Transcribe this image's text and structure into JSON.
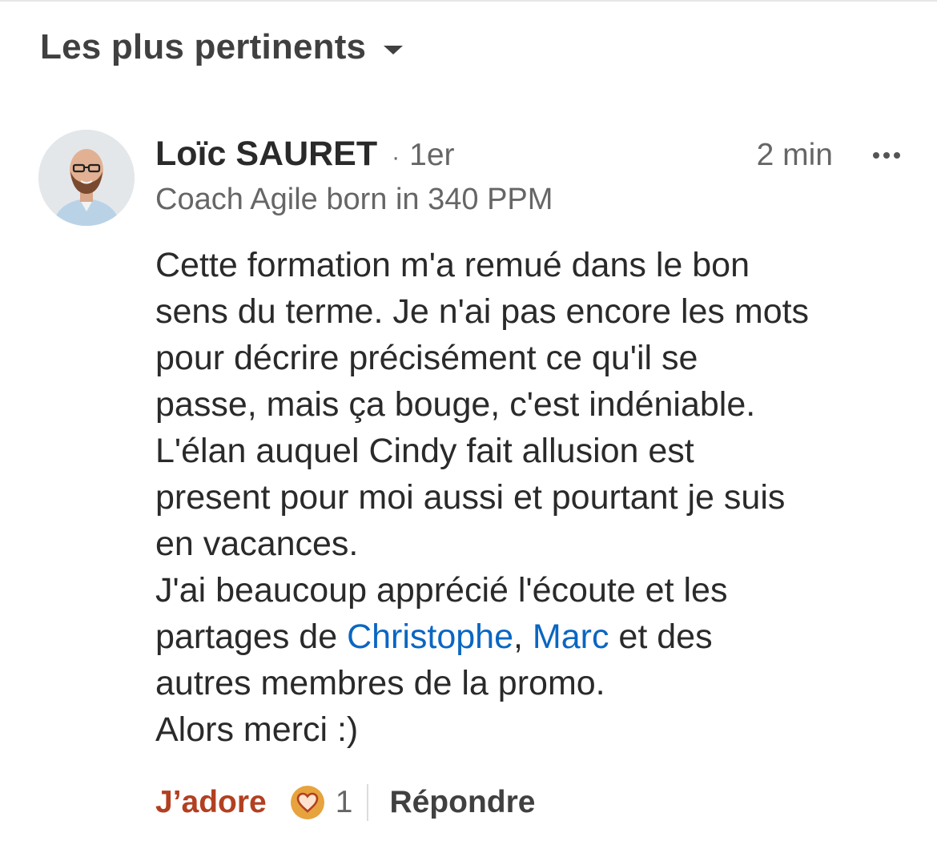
{
  "sort": {
    "label": "Les plus pertinents"
  },
  "comment": {
    "author": "Loïc SAURET",
    "separator": "·",
    "degree": "1er",
    "headline": "Coach Agile born in 340 PPM",
    "time": "2 min",
    "body": {
      "line1": "Cette formation m'a remué dans le bon",
      "line2": "sens du terme. Je n'ai pas encore les mots",
      "line3": "pour décrire précisément ce qu'il se",
      "line4": "passe, mais ça bouge, c'est indéniable.",
      "line5": "L'élan auquel Cindy fait allusion est",
      "line6": "present pour moi aussi et pourtant je suis",
      "line7": "en vacances.",
      "line8": "J'ai beaucoup apprécié l'écoute et les",
      "line9_prefix": "partages de ",
      "mention1": "Christophe",
      "line9_comma": ", ",
      "mention2": "Marc",
      "line9_suffix": " et des",
      "line10": "autres membres de la promo.",
      "line11": "Alors merci :)"
    },
    "actions": {
      "react_label": "J’adore",
      "reaction_count": "1",
      "reply_label": "Répondre"
    }
  },
  "colors": {
    "react": "#b24020",
    "mention": "#0a66c2",
    "badge": "#e7a33e"
  }
}
